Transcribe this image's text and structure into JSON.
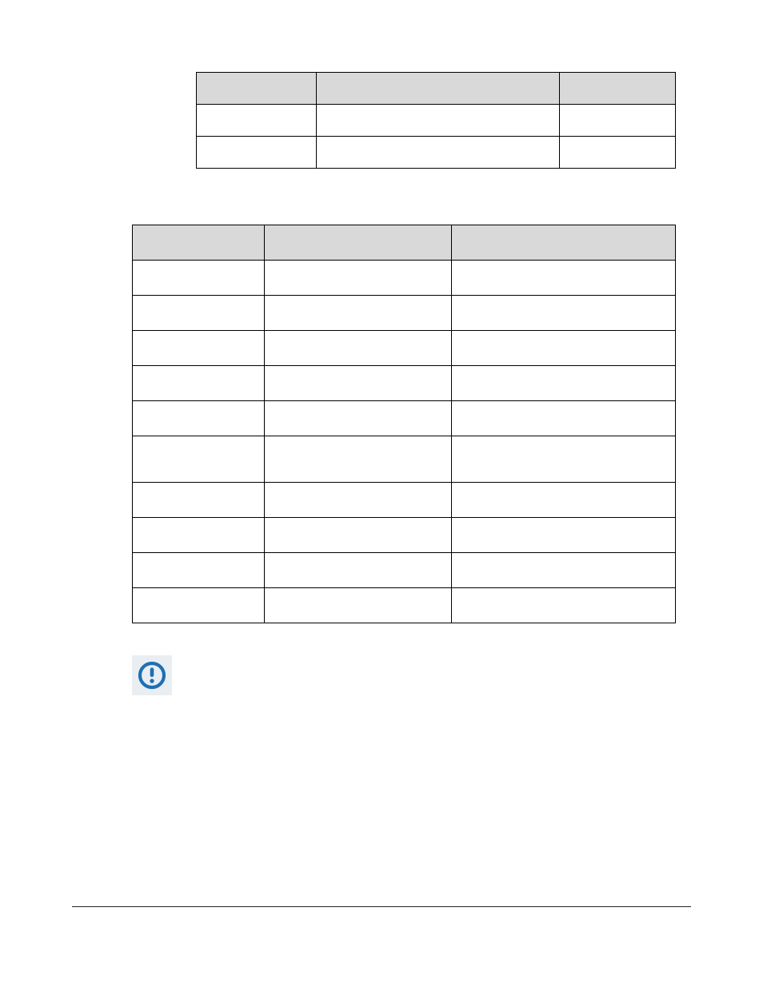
{
  "table1": {
    "headers": [
      "",
      "",
      ""
    ],
    "rows": [
      [
        "",
        "",
        ""
      ],
      [
        "",
        "",
        ""
      ]
    ]
  },
  "table2": {
    "headers": [
      "",
      "",
      ""
    ],
    "rows": [
      [
        "",
        "",
        ""
      ],
      [
        "",
        "",
        ""
      ],
      [
        "",
        "",
        ""
      ],
      [
        "",
        "",
        ""
      ],
      [
        "",
        "",
        ""
      ],
      [
        "",
        "",
        ""
      ],
      [
        "",
        "",
        ""
      ],
      [
        "",
        "",
        ""
      ],
      [
        "",
        "",
        ""
      ],
      [
        "",
        "",
        ""
      ]
    ],
    "tall_row": 5
  },
  "note": {
    "icon": "alert-circle-icon",
    "text": ""
  },
  "footer": {
    "left": "",
    "right": ""
  }
}
